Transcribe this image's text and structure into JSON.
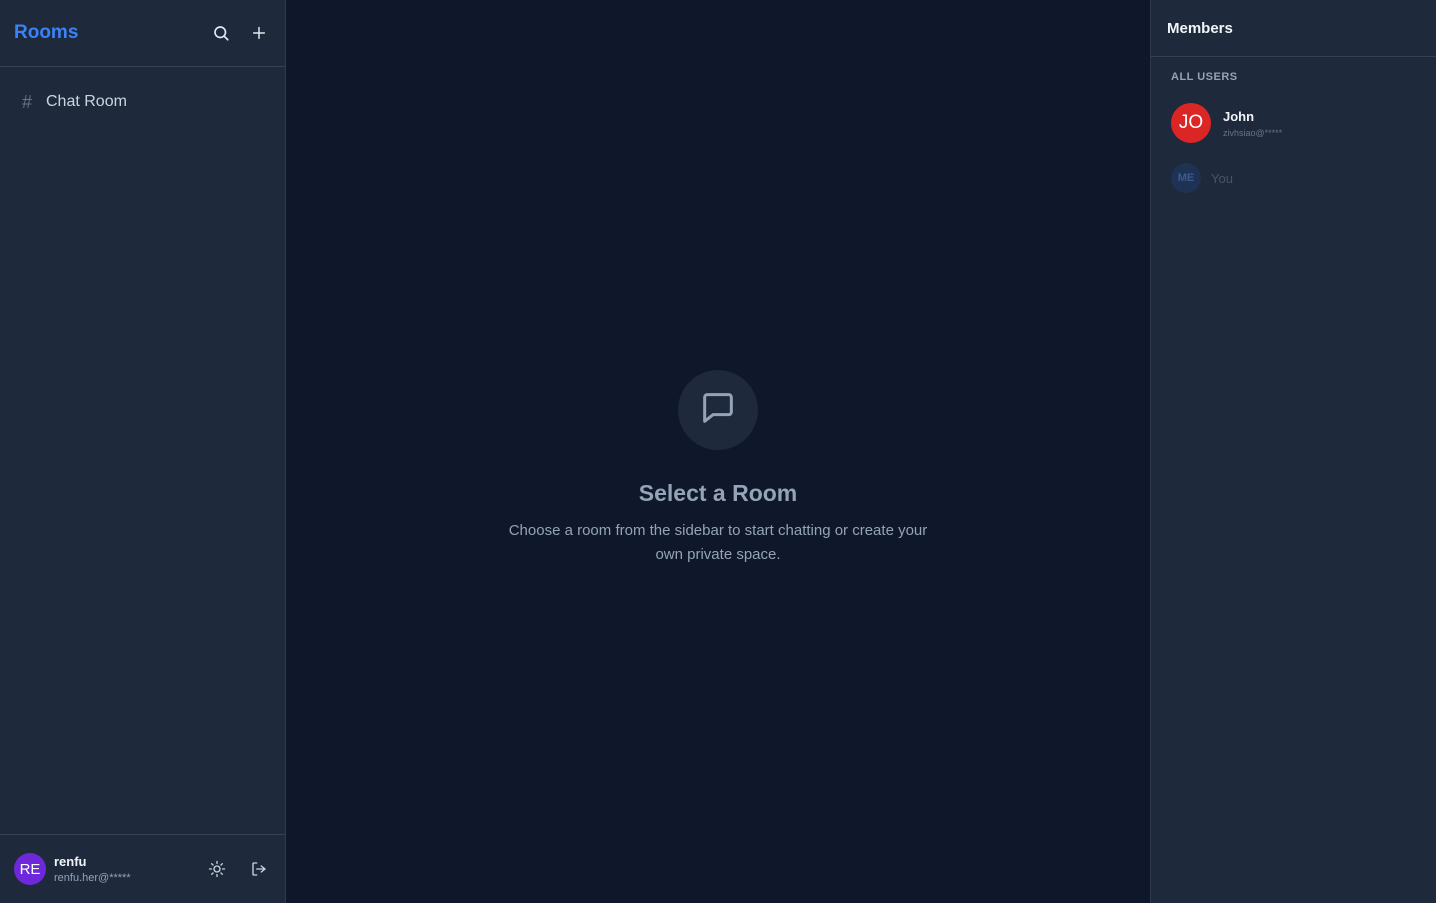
{
  "sidebar": {
    "title": "Rooms",
    "icons": {
      "search": "search-icon",
      "add": "plus-icon"
    },
    "rooms": [
      {
        "prefix": "#",
        "label": "Chat Room"
      }
    ],
    "current_user": {
      "initials": "RE",
      "name": "renfu",
      "email": "renfu.her@*****"
    },
    "footer_icons": {
      "theme": "sun-icon",
      "logout": "logout-icon"
    }
  },
  "main": {
    "empty_state": {
      "icon": "message-square-icon",
      "title": "Select a Room",
      "description": "Choose a room from the sidebar to start chatting or create your own private space."
    }
  },
  "members": {
    "title": "Members",
    "section_label": "ALL USERS",
    "users": [
      {
        "initials": "JO",
        "name": "John",
        "email": "zivhsiao@*****"
      }
    ],
    "self": {
      "initials": "ME",
      "label": "You"
    }
  },
  "colors": {
    "accent": "#3b82f6",
    "background": "#0f172a",
    "panel": "#1e293b",
    "john_avatar": "#dc2626",
    "me_avatar": "#6d28d9"
  }
}
